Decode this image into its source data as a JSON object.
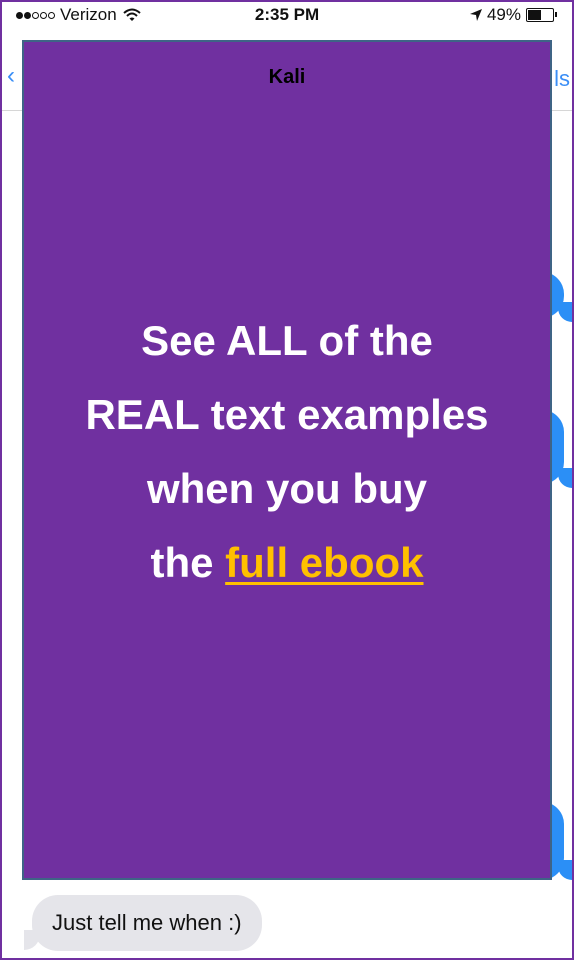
{
  "status_bar": {
    "signal_bars_filled": 2,
    "signal_bars_total": 5,
    "carrier": "Verizon",
    "wifi_icon": "wifi-icon",
    "time": "2:35 PM",
    "location_icon": "location-arrow-icon",
    "battery_percent": "49%",
    "battery_level": 0.49
  },
  "nav": {
    "back_icon": "chevron-left-icon",
    "right_text": "ls"
  },
  "overlay": {
    "title": "Kali",
    "lines": [
      "See ALL of the",
      "REAL text examples",
      "when you buy"
    ],
    "last_line_prefix": "the",
    "link_text": "full ebook",
    "background_color": "#7030a0",
    "link_color": "#ffc000",
    "text_color": "#ffffff"
  },
  "messages": {
    "received_last": "Just tell me when :)"
  },
  "colors": {
    "imessage_blue": "#2b8ff6",
    "received_gray": "#e5e5ea",
    "frame_border": "#7030a0"
  }
}
